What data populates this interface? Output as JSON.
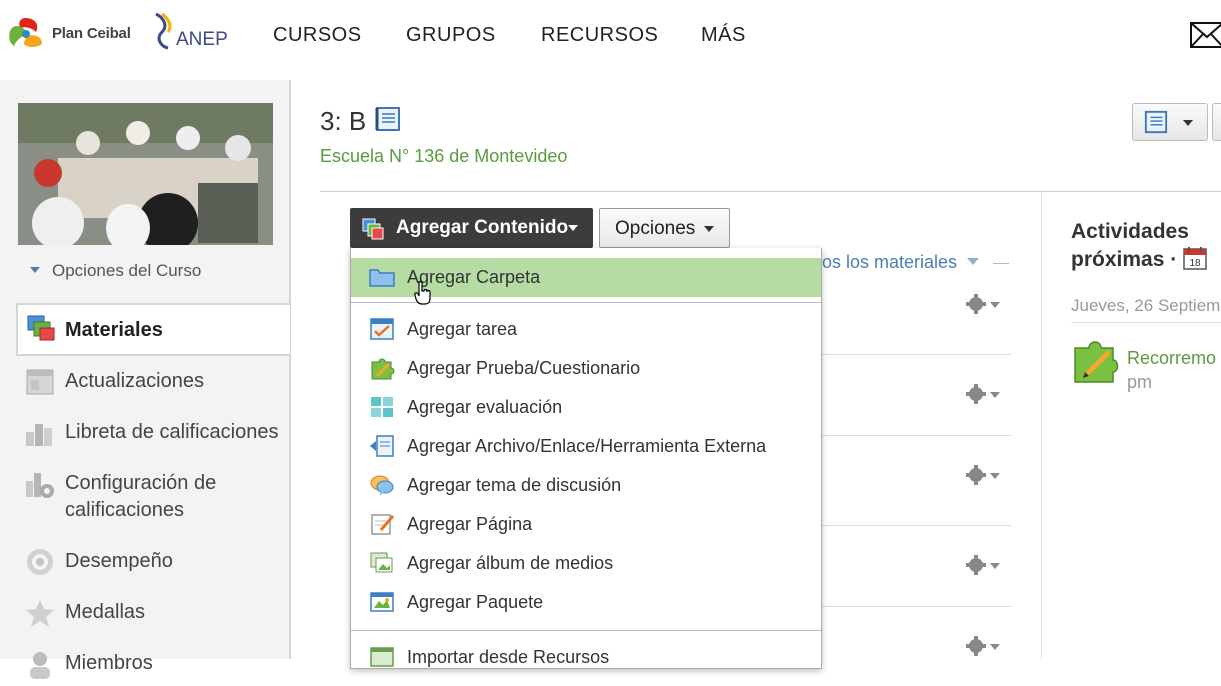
{
  "brand": {
    "ceibal": "Plan Ceibal",
    "anep": "ANEP"
  },
  "nav": {
    "items": [
      "CURSOS",
      "GRUPOS",
      "RECURSOS",
      "MÁS"
    ]
  },
  "sidebar": {
    "course_options": "Opciones del Curso",
    "items": [
      {
        "label": "Materiales",
        "icon": "materials-icon",
        "active": true
      },
      {
        "label": "Actualizaciones",
        "icon": "updates-icon"
      },
      {
        "label": "Libreta de calificaciones",
        "icon": "gradebook-icon"
      },
      {
        "label": "Configuración de calificaciones",
        "icon": "grade-settings-icon"
      },
      {
        "label": "Desempeño",
        "icon": "performance-icon"
      },
      {
        "label": "Medallas",
        "icon": "badge-icon"
      },
      {
        "label": "Miembros",
        "icon": "members-icon"
      }
    ]
  },
  "main": {
    "course_title": "3: B",
    "school": "Escuela N° 136 de Montevideo",
    "add_button": "Agregar Contenido",
    "options_button": "Opciones",
    "materials_filter": "os los materiales"
  },
  "dropdown": {
    "items": [
      {
        "label": "Agregar Carpeta",
        "icon": "folder-icon",
        "highlighted": true
      },
      {
        "label": "Agregar tarea",
        "icon": "assignment-icon"
      },
      {
        "label": "Agregar Prueba/Cuestionario",
        "icon": "quiz-puzzle-icon"
      },
      {
        "label": "Agregar evaluación",
        "icon": "assessment-icon"
      },
      {
        "label": "Agregar Archivo/Enlace/Herramienta Externa",
        "icon": "file-link-icon"
      },
      {
        "label": "Agregar tema de discusión",
        "icon": "discussion-icon"
      },
      {
        "label": "Agregar Página",
        "icon": "page-icon"
      },
      {
        "label": "Agregar álbum de medios",
        "icon": "media-album-icon"
      },
      {
        "label": "Agregar Paquete",
        "icon": "package-icon"
      },
      {
        "label": "Importar desde Recursos",
        "icon": "import-icon"
      }
    ]
  },
  "upcoming": {
    "title_line1": "Actividades",
    "title_line2": "próximas ·",
    "calendar_day": "18",
    "date": "Jueves, 26 Septiem",
    "event_title": "Recorremo",
    "event_time": "pm"
  },
  "colors": {
    "accent_green": "#5a9a3e",
    "link_blue": "#4a7fb3",
    "highlight": "#b5dca2",
    "dark_button": "#3c3c3c"
  }
}
